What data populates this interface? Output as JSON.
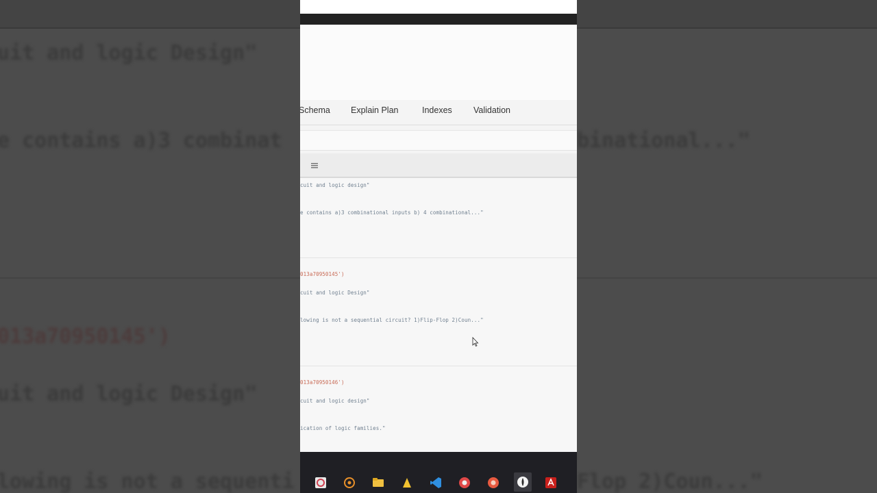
{
  "tabs": {
    "schema": "Schema",
    "explain_plan": "Explain Plan",
    "indexes": "Indexes",
    "validation": "Validation"
  },
  "documents": [
    {
      "line1": "cuit and logic design\"",
      "line2": "e contains a)3 combinational inputs b) 4 combinational...\""
    },
    {
      "id": "013a70950145')",
      "line1": "cuit and logic Design\"",
      "line2": "lowing is not a sequential circuit? 1)Flip-Flop 2)Coun...\""
    },
    {
      "id": "013a70950146')",
      "line1": "cuit and logic design\"",
      "line2": "ication of logic families.\""
    }
  ],
  "background_text": {
    "t1": "uit and logic Design\"",
    "t2": "e contains a)3 combinat",
    "t3": "binational...\"",
    "t4": "013a70950145')",
    "t5": "uit and logic Design\"",
    "t6": "lowing is not a sequenti",
    "t7": "Flop 2)Coun...\""
  },
  "colors": {
    "background": "#4a4a4a",
    "frame": "#f4f4f4",
    "id_text": "#c86a55",
    "value_text": "#6f7f8f",
    "taskbar": "#1f1f24"
  },
  "taskbar_icons": [
    "snipping-tool-icon",
    "media-player-icon",
    "file-explorer-icon",
    "notes-icon",
    "vscode-icon",
    "chrome-icon",
    "chrome-alt-icon",
    "mongodb-compass-icon",
    "acrobat-icon"
  ]
}
